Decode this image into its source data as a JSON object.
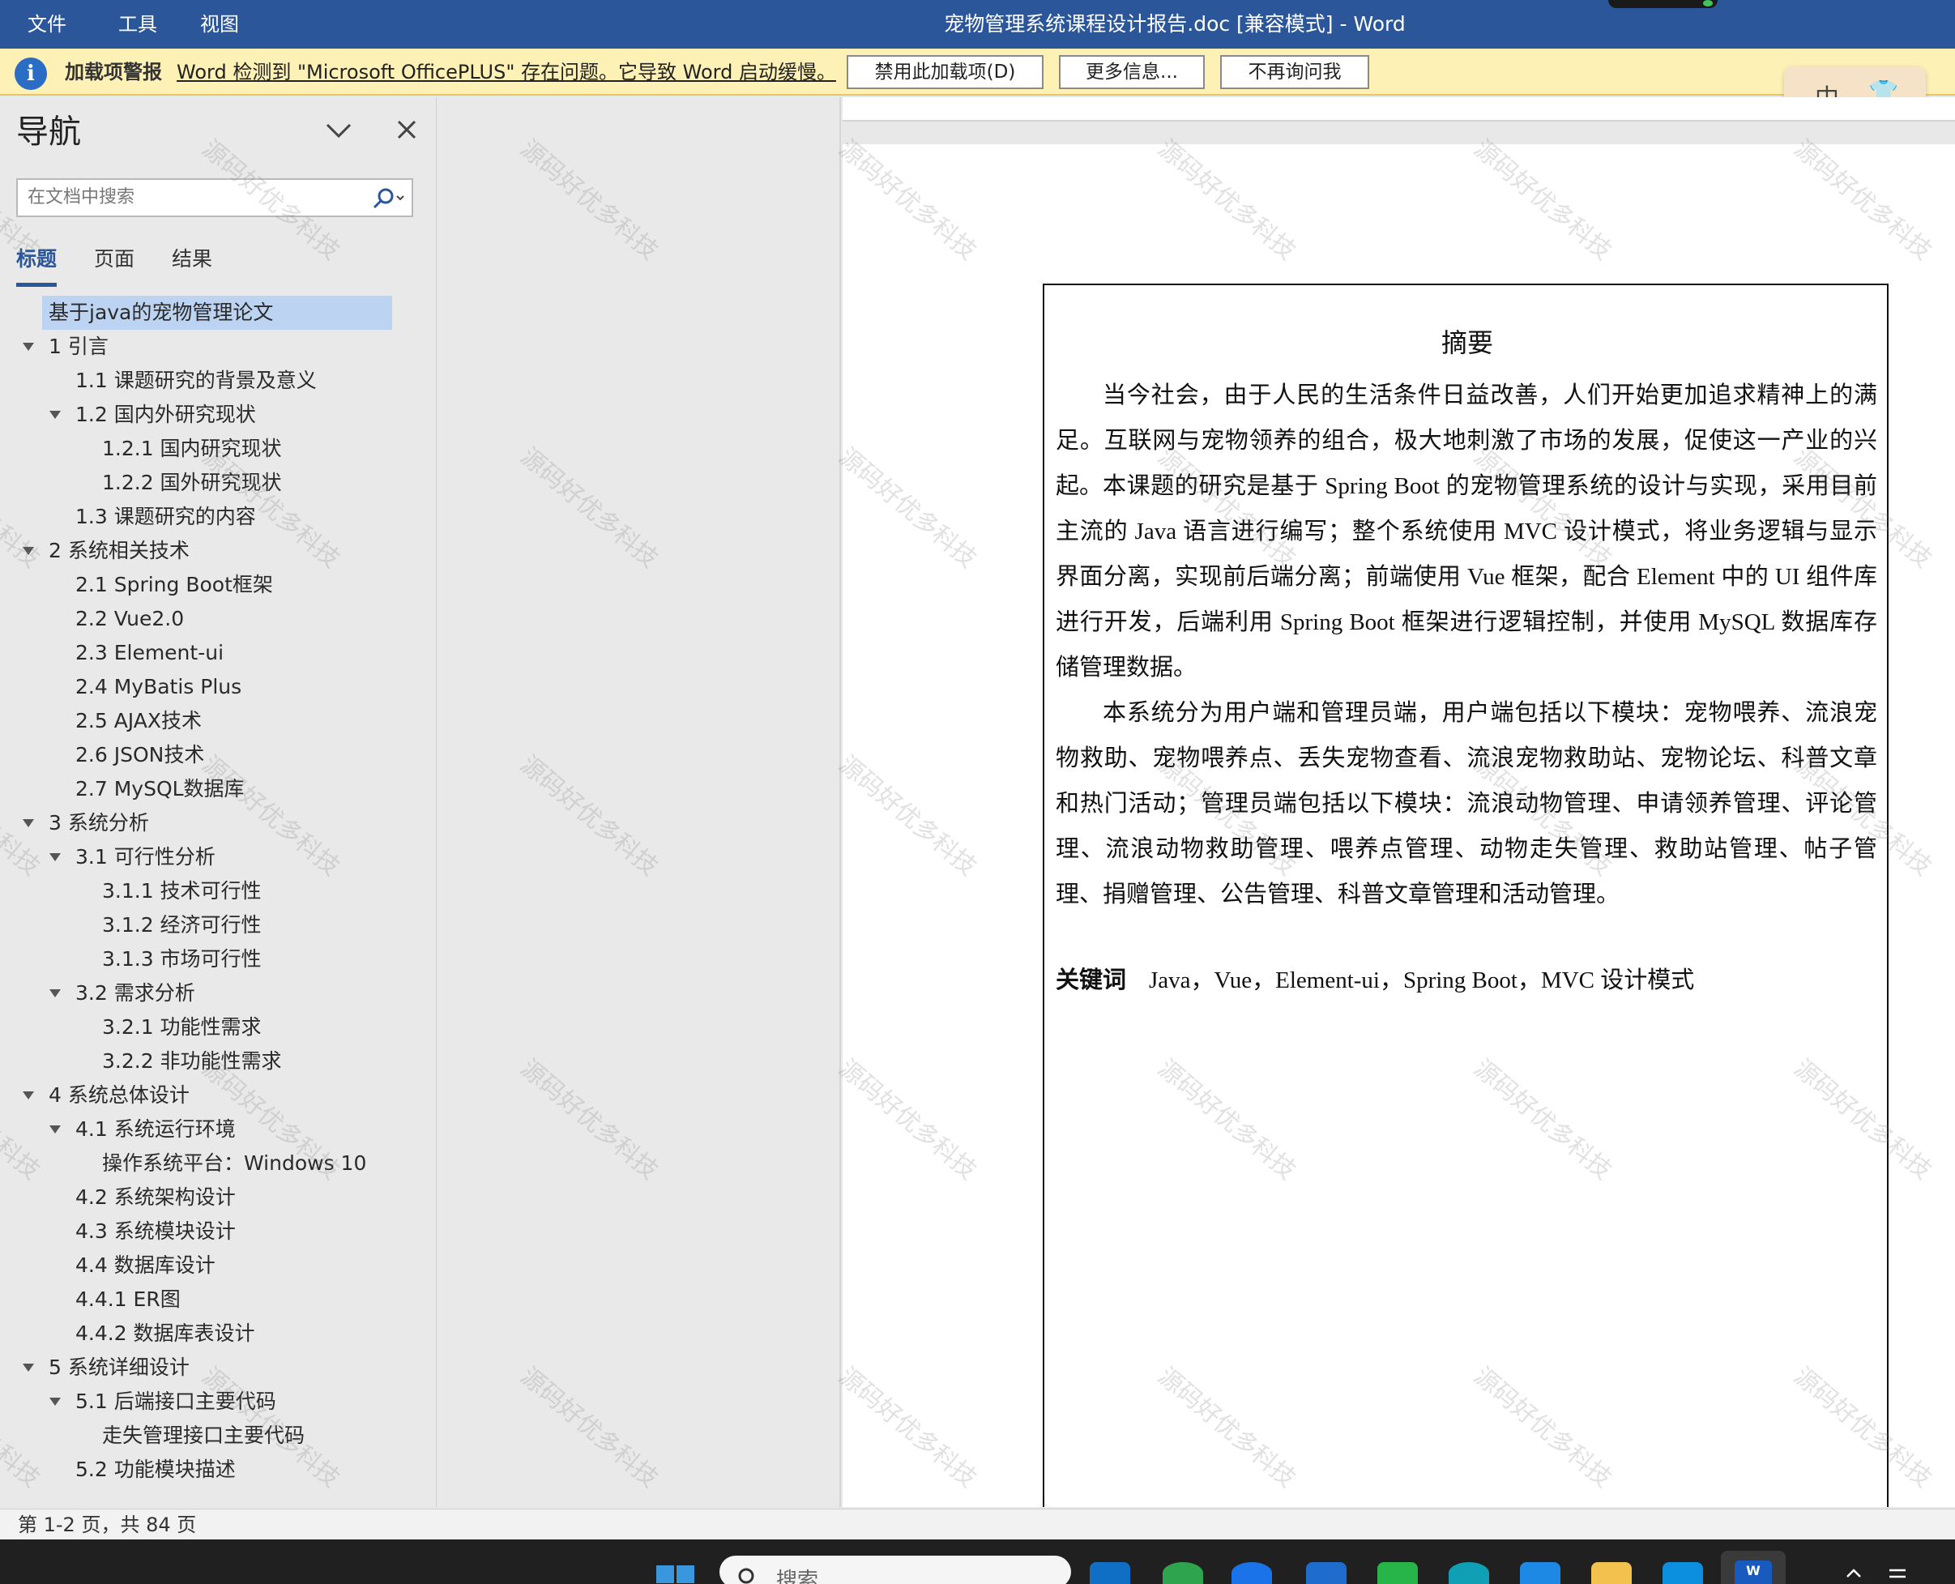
{
  "titlebar": {
    "menu": [
      "文件",
      "工具",
      "视图"
    ],
    "doc_title": "宠物管理系统课程设计报告.doc [兼容模式]  -  Word"
  },
  "infobar": {
    "label": "加载项警报",
    "message": "Word 检测到 \"Microsoft OfficePLUS\" 存在问题。它导致 Word 启动缓慢。",
    "buttons": [
      "禁用此加载项(D)",
      "更多信息...",
      "不再询问我"
    ]
  },
  "ime": {
    "mode": "中",
    "icon": "shirt-icon"
  },
  "nav": {
    "title": "导航",
    "search_placeholder": "在文档中搜索",
    "tabs": [
      "标题",
      "页面",
      "结果"
    ],
    "active_tab": "标题",
    "items": [
      {
        "text": "基于java的宠物管理论文",
        "level": 1,
        "selected": true,
        "expander": false
      },
      {
        "text": "1  引言",
        "level": 1,
        "expander": true
      },
      {
        "text": "1.1  课题研究的背景及意义",
        "level": 2,
        "expander": false
      },
      {
        "text": "1.2  国内外研究现状",
        "level": 2,
        "expander": true
      },
      {
        "text": "1.2.1  国内研究现状",
        "level": 3,
        "expander": false
      },
      {
        "text": "1.2.2  国外研究现状",
        "level": 3,
        "expander": false
      },
      {
        "text": "1.3  课题研究的内容",
        "level": 2,
        "expander": false
      },
      {
        "text": "2  系统相关技术",
        "level": 1,
        "expander": true
      },
      {
        "text": "2.1  Spring Boot框架",
        "level": 2,
        "expander": false
      },
      {
        "text": "2.2  Vue2.0",
        "level": 2,
        "expander": false
      },
      {
        "text": "2.3  Element-ui",
        "level": 2,
        "expander": false
      },
      {
        "text": "2.4  MyBatis Plus",
        "level": 2,
        "expander": false
      },
      {
        "text": "2.5  AJAX技术",
        "level": 2,
        "expander": false
      },
      {
        "text": "2.6  JSON技术",
        "level": 2,
        "expander": false
      },
      {
        "text": "2.7  MySQL数据库",
        "level": 2,
        "expander": false
      },
      {
        "text": "3  系统分析",
        "level": 1,
        "expander": true
      },
      {
        "text": "3.1  可行性分析",
        "level": 2,
        "expander": true
      },
      {
        "text": "3.1.1  技术可行性",
        "level": 3,
        "expander": false
      },
      {
        "text": "3.1.2  经济可行性",
        "level": 3,
        "expander": false
      },
      {
        "text": "3.1.3  市场可行性",
        "level": 3,
        "expander": false
      },
      {
        "text": "3.2  需求分析",
        "level": 2,
        "expander": true
      },
      {
        "text": "3.2.1  功能性需求",
        "level": 3,
        "expander": false
      },
      {
        "text": "3.2.2  非功能性需求",
        "level": 3,
        "expander": false
      },
      {
        "text": "4  系统总体设计",
        "level": 1,
        "expander": true
      },
      {
        "text": "4.1  系统运行环境",
        "level": 2,
        "expander": true
      },
      {
        "text": "操作系统平台：Windows 10",
        "level": 3,
        "expander": false
      },
      {
        "text": "4.2  系统架构设计",
        "level": 2,
        "expander": false
      },
      {
        "text": "4.3  系统模块设计",
        "level": 2,
        "expander": false
      },
      {
        "text": "4.4  数据库设计",
        "level": 2,
        "expander": false
      },
      {
        "text": "4.4.1 ER图",
        "level": 2,
        "expander": false
      },
      {
        "text": "4.4.2 数据库表设计",
        "level": 2,
        "expander": false
      },
      {
        "text": "5  系统详细设计",
        "level": 1,
        "expander": true
      },
      {
        "text": "5.1 后端接口主要代码",
        "level": 2,
        "expander": true
      },
      {
        "text": "走失管理接口主要代码",
        "level": 3,
        "expander": false
      },
      {
        "text": "5.2 功能模块描述",
        "level": 2,
        "expander": false
      }
    ]
  },
  "document": {
    "abstract_title": "摘要",
    "paragraphs": [
      "当今社会，由于人民的生活条件日益改善，人们开始更加追求精神上的满足。互联网与宠物领养的组合，极大地刺激了市场的发展，促使这一产业的兴起。",
      "本课题的研究是基于 Spring Boot 的宠物管理系统的设计与实现，采用目前主流的 Java 语言进行编写；整个系统使用 MVC 设计模式，将业务逻辑与显示界面分离，实现前后端分离；前端使用 Vue 框架，配合 Element 中的 UI 组件库进行开发，后端利用 Spring Boot 框架进行逻辑控制，并使用 MySQL 数据库存储管理数据。",
      "本系统分为用户端和管理员端，用户端包括以下模块：宠物喂养、流浪宠物救助、宠物喂养点、丢失宠物查看、流浪宠物救助站、宠物论坛、科普文章和热门活动；管理员端包括以下模块：流浪动物管理、申请领养管理、评论管理、流浪动物救助管理、喂养点管理、动物走失管理、救助站管理、帖子管理、捐赠管理、公告管理、科普文章管理和活动管理。"
    ],
    "keywords_label": "关键词",
    "keywords": "Java，Vue，Element-ui，Spring Boot，MVC 设计模式",
    "watermark": "源码好优多科技"
  },
  "statusbar": {
    "page_info": "第 1-2 页，共 84 页"
  },
  "taskbar": {
    "search_placeholder": "搜索",
    "apps": [
      "vscode-icon",
      "wechat-icon",
      "browser-icon",
      "edge-icon",
      "app-store-icon",
      "file-explorer-icon",
      "word-icon"
    ]
  }
}
